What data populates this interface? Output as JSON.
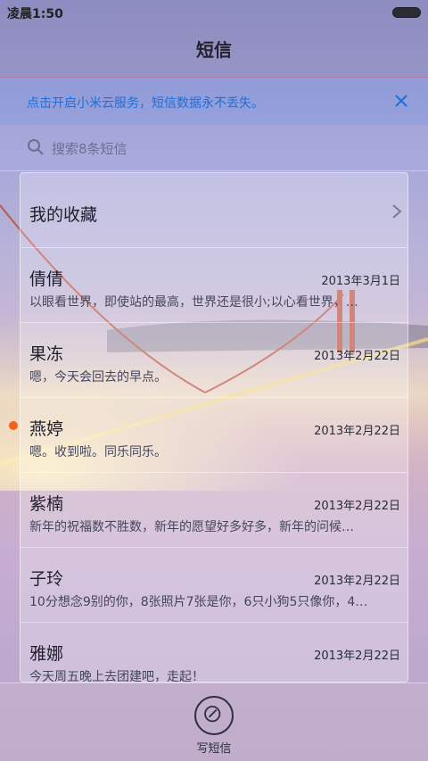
{
  "status_bar": {
    "time": "凌晨1:50"
  },
  "header": {
    "title": "短信"
  },
  "cloud_banner": {
    "text": "点击开启小米云服务，短信数据永不丢失。"
  },
  "search": {
    "placeholder": "搜索8条短信"
  },
  "favorites": {
    "label": "我的收藏"
  },
  "conversations": [
    {
      "name": "倩倩",
      "date": "2013年3月1日",
      "preview": "以眼看世界，即使站的最高，世界还是很小;以心看世界，…",
      "unread": false
    },
    {
      "name": "果冻",
      "date": "2013年2月22日",
      "preview": "嗯，今天会回去的早点。",
      "unread": false
    },
    {
      "name": "燕婷",
      "date": "2013年2月22日",
      "preview": "嗯。收到啦。同乐同乐。",
      "unread": true
    },
    {
      "name": "紫楠",
      "date": "2013年2月22日",
      "preview": "新年的祝福数不胜数，新年的愿望好多好多，新年的问候…",
      "unread": false
    },
    {
      "name": "子玲",
      "date": "2013年2月22日",
      "preview": "10分想念9别的你，8张照片7张是你，6只小狗5只像你，4…",
      "unread": false
    },
    {
      "name": "雅娜",
      "date": "2013年2月22日",
      "preview": "今天周五晚上去团建吧，走起！",
      "unread": false
    }
  ],
  "bottom_bar": {
    "compose_label": "写短信"
  },
  "colors": {
    "accent": "#1e6fd8",
    "unread_dot": "#f3611d"
  }
}
